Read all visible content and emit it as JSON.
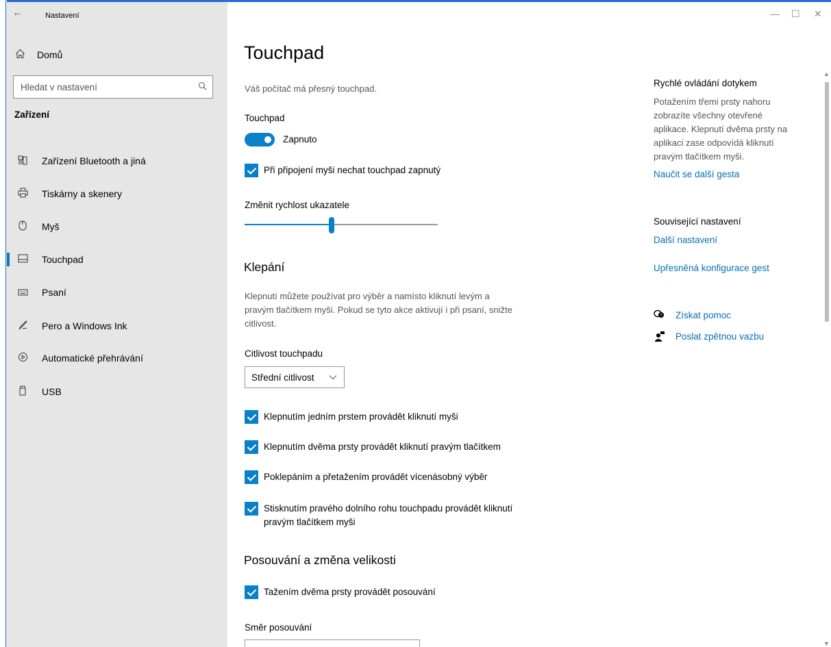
{
  "window": {
    "title": "Nastavení",
    "back_icon": "←",
    "minimize": "—",
    "maximize": "☐",
    "close": "✕"
  },
  "sidebar": {
    "home_label": "Domů",
    "search_placeholder": "Hledat v nastavení",
    "section_title": "Zařízení",
    "items": [
      {
        "label": "Zařízení Bluetooth a jiná",
        "icon": "bluetooth-devices-icon"
      },
      {
        "label": "Tiskárny a skenery",
        "icon": "printer-icon"
      },
      {
        "label": "Myš",
        "icon": "mouse-icon"
      },
      {
        "label": "Touchpad",
        "icon": "touchpad-icon"
      },
      {
        "label": "Psaní",
        "icon": "keyboard-icon"
      },
      {
        "label": "Pero a Windows Ink",
        "icon": "pen-icon"
      },
      {
        "label": "Automatické přehrávání",
        "icon": "autoplay-icon"
      },
      {
        "label": "USB",
        "icon": "usb-icon"
      }
    ],
    "active_item": "Touchpad"
  },
  "main": {
    "title": "Touchpad",
    "subtitle": "Váš počítač má přesný touchpad.",
    "touchpad_label": "Touchpad",
    "toggle_state": "Zapnuto",
    "keep_on_with_mouse": "Při připojení myši nechat touchpad zapnutý",
    "pointer_speed_label": "Změnit rychlost ukazatele",
    "pointer_speed_fraction": 0.45,
    "tapping": {
      "heading": "Klepání",
      "description_line1": "Klepnutí můžete používat pro výběr a namísto kliknutí levým a",
      "description_line2": "pravým tlačítkem myši. Pokud se tyto akce aktivují i při psaní, snižte",
      "description_line3": "citlivost.",
      "sensitivity_label": "Citlivost touchpadu",
      "sensitivity_value": "Střední citlivost",
      "options": [
        "Klepnutím jedním prstem provádět kliknutí myši",
        "Klepnutím dvěma prsty provádět kliknutí pravým tlačítkem",
        "Poklepáním a přetažením provádět vícenásobný výběr"
      ],
      "corner_option_line1": "Stisknutím pravého dolního rohu touchpadu provádět kliknutí",
      "corner_option_line2": "pravým tlačítkem myši"
    },
    "scroll": {
      "heading": "Posouvání a změna velikosti",
      "two_finger_scroll": "Tažením dvěma prsty provádět posouvání",
      "direction_label": "Směr posouvání"
    }
  },
  "right_panel": {
    "quick_title": "Rychlé ovládání dotykem",
    "quick_lines": [
      "Potažením třemi prsty nahoru",
      "zobrazíte všechny otevřené",
      "aplikace. Klepnutí dvěma prsty na",
      "aplikaci zase odpovídá kliknutí",
      "pravým tlačítkem myši."
    ],
    "learn_more": "Naučit se další gesta",
    "related_title": "Související nastavení",
    "more_settings": "Další nastavení",
    "advanced_gestures": "Upřesněná konfigurace gest",
    "get_help": "Získat pomoc",
    "send_feedback": "Poslat zpětnou vazbu"
  }
}
